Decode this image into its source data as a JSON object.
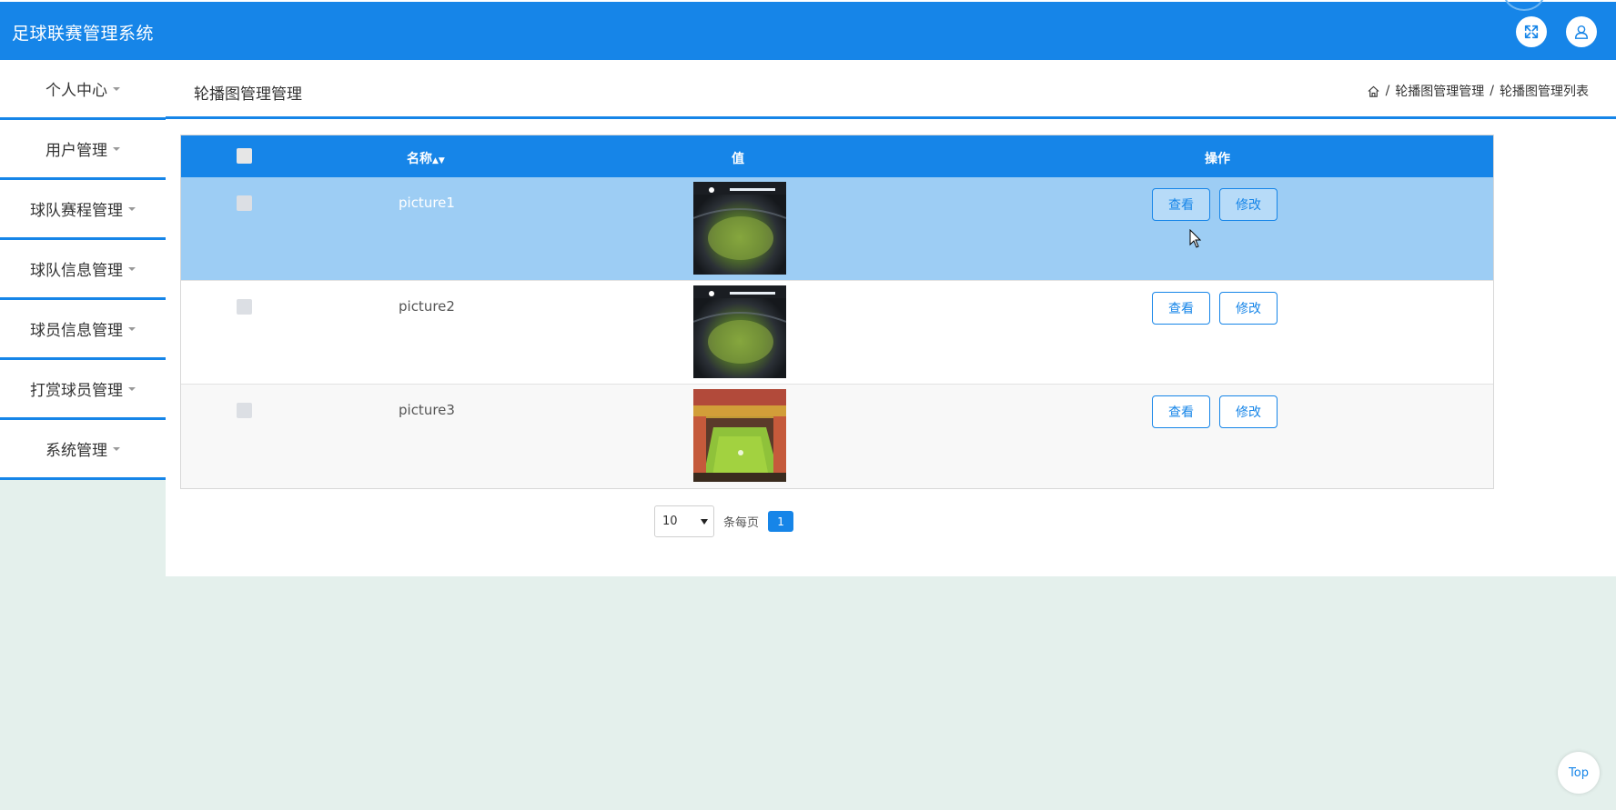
{
  "header": {
    "app_title": "足球联赛管理系统",
    "fullscreen_icon": "expand-arrows-icon",
    "user_icon": "user-icon"
  },
  "sidebar": {
    "items": [
      {
        "label": "个人中心"
      },
      {
        "label": "用户管理"
      },
      {
        "label": "球队赛程管理"
      },
      {
        "label": "球队信息管理"
      },
      {
        "label": "球员信息管理"
      },
      {
        "label": "打赏球员管理"
      },
      {
        "label": "系统管理"
      }
    ]
  },
  "page": {
    "title": "轮播图管理管理",
    "breadcrumb": {
      "home_icon": "home-icon",
      "separator": "/",
      "level1": "轮播图管理管理",
      "level2": "轮播图管理列表"
    }
  },
  "table": {
    "columns": {
      "name": "名称",
      "value": "值",
      "ops": "操作"
    },
    "rows": [
      {
        "name": "picture1",
        "view_label": "查看",
        "edit_label": "修改"
      },
      {
        "name": "picture2",
        "view_label": "查看",
        "edit_label": "修改"
      },
      {
        "name": "picture3",
        "view_label": "查看",
        "edit_label": "修改"
      }
    ]
  },
  "pagination": {
    "page_size": "10",
    "per_page_label": "条每页",
    "current_page": "1"
  },
  "top_button": "Top",
  "colors": {
    "primary": "#1685e8",
    "selected_row": "#9dcdf4",
    "background": "#e4f0ec"
  }
}
